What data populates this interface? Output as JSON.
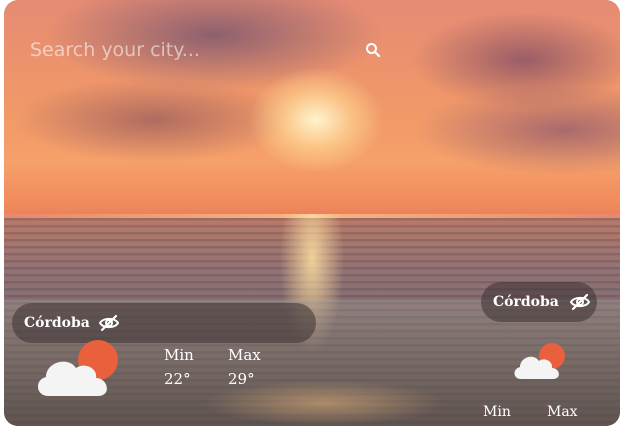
{
  "search": {
    "placeholder": "Search your city..."
  },
  "icons": {
    "search": "search-icon",
    "visibility": "eye-off-icon",
    "weather": "sun-behind-cloud-icon"
  },
  "colors": {
    "sun": "#e8603c",
    "cloud": "#f4f4f4",
    "pill_bg": "#3c3232"
  },
  "cards": [
    {
      "city": "Córdoba",
      "min_label": "Min",
      "max_label": "Max",
      "min_value": "22°",
      "max_value": "29°"
    },
    {
      "city": "Córdoba",
      "min_label": "Min",
      "max_label": "Max"
    }
  ]
}
